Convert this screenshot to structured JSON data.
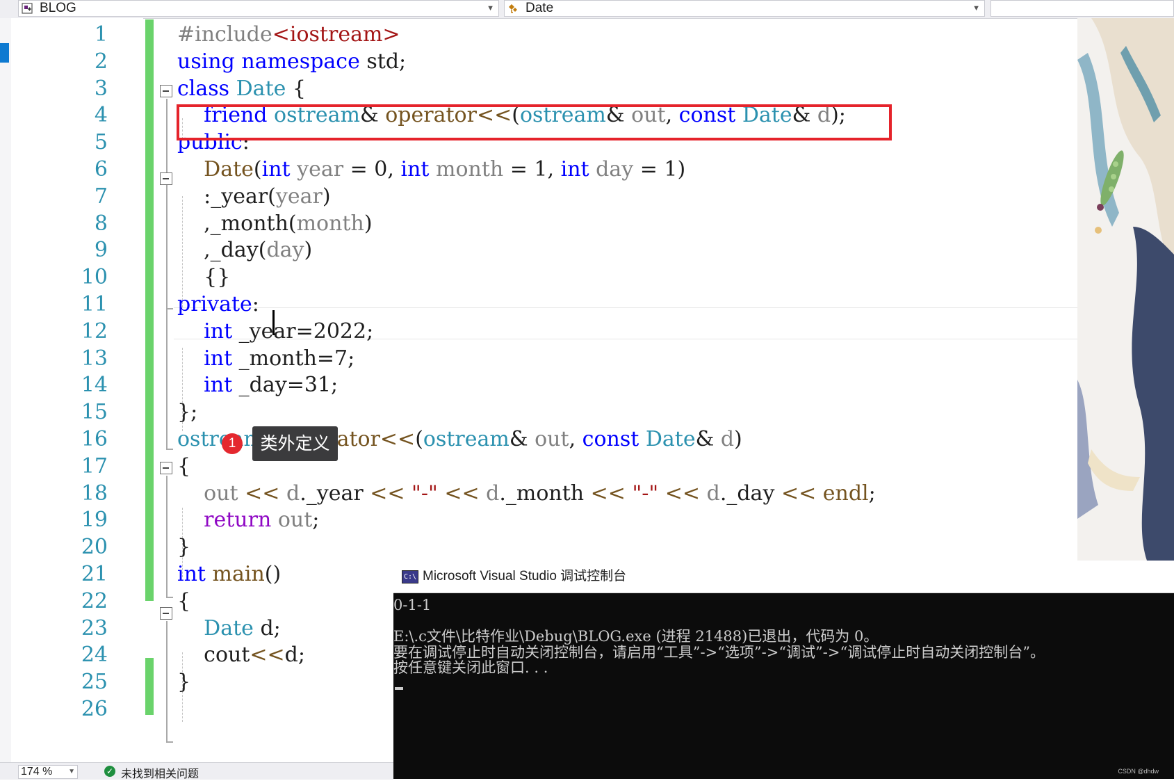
{
  "nav": {
    "project": "BLOG",
    "member": "Date",
    "right": ""
  },
  "editor": {
    "line_numbers": [
      "1",
      "2",
      "3",
      "4",
      "5",
      "6",
      "7",
      "8",
      "9",
      "10",
      "11",
      "12",
      "13",
      "14",
      "15",
      "16",
      "17",
      "18",
      "19",
      "20",
      "21",
      "22",
      "23",
      "24",
      "25",
      "26"
    ],
    "lines": [
      [
        {
          "t": "#include",
          "c": "pp"
        },
        {
          "t": "<iostream>",
          "c": "inc"
        }
      ],
      [
        {
          "t": "using",
          "c": "kw"
        },
        {
          "t": " "
        },
        {
          "t": "namespace",
          "c": "kw"
        },
        {
          "t": " std;"
        }
      ],
      [
        {
          "t": "class",
          "c": "kw"
        },
        {
          "t": " "
        },
        {
          "t": "Date",
          "c": "ty"
        },
        {
          "t": " {"
        }
      ],
      [
        {
          "t": "    "
        },
        {
          "t": "friend",
          "c": "kw"
        },
        {
          "t": " "
        },
        {
          "t": "ostream",
          "c": "ty"
        },
        {
          "t": "& "
        },
        {
          "t": "operator<<",
          "c": "fn"
        },
        {
          "t": "("
        },
        {
          "t": "ostream",
          "c": "ty"
        },
        {
          "t": "& "
        },
        {
          "t": "out",
          "c": "pm"
        },
        {
          "t": ", "
        },
        {
          "t": "const",
          "c": "kw"
        },
        {
          "t": " "
        },
        {
          "t": "Date",
          "c": "ty"
        },
        {
          "t": "& "
        },
        {
          "t": "d",
          "c": "pm"
        },
        {
          "t": ");"
        }
      ],
      [
        {
          "t": "public",
          "c": "kw"
        },
        {
          "t": ":"
        }
      ],
      [
        {
          "t": "    "
        },
        {
          "t": "Date",
          "c": "fn"
        },
        {
          "t": "("
        },
        {
          "t": "int",
          "c": "kw"
        },
        {
          "t": " "
        },
        {
          "t": "year",
          "c": "pm"
        },
        {
          "t": " = 0, "
        },
        {
          "t": "int",
          "c": "kw"
        },
        {
          "t": " "
        },
        {
          "t": "month",
          "c": "pm"
        },
        {
          "t": " = 1, "
        },
        {
          "t": "int",
          "c": "kw"
        },
        {
          "t": " "
        },
        {
          "t": "day",
          "c": "pm"
        },
        {
          "t": " = 1)"
        }
      ],
      [
        {
          "t": "    :_year("
        },
        {
          "t": "year",
          "c": "pm"
        },
        {
          "t": ")"
        }
      ],
      [
        {
          "t": "    ,_month("
        },
        {
          "t": "month",
          "c": "pm"
        },
        {
          "t": ")"
        }
      ],
      [
        {
          "t": "    ,_day("
        },
        {
          "t": "day",
          "c": "pm"
        },
        {
          "t": ")"
        }
      ],
      [
        {
          "t": "    {}"
        }
      ],
      [
        {
          "t": "private",
          "c": "kw"
        },
        {
          "t": ":"
        }
      ],
      [
        {
          "t": "    "
        },
        {
          "t": "int",
          "c": "kw"
        },
        {
          "t": " _year=2022;"
        }
      ],
      [
        {
          "t": "    "
        },
        {
          "t": "int",
          "c": "kw"
        },
        {
          "t": " _month=7;"
        }
      ],
      [
        {
          "t": "    "
        },
        {
          "t": "int",
          "c": "kw"
        },
        {
          "t": " _day=31;"
        }
      ],
      [
        {
          "t": "};"
        }
      ],
      [
        {
          "t": "ostream",
          "c": "ty"
        },
        {
          "t": "& "
        },
        {
          "t": "operator<<",
          "c": "fn"
        },
        {
          "t": "("
        },
        {
          "t": "ostream",
          "c": "ty"
        },
        {
          "t": "& "
        },
        {
          "t": "out",
          "c": "pm"
        },
        {
          "t": ", "
        },
        {
          "t": "const",
          "c": "kw"
        },
        {
          "t": " "
        },
        {
          "t": "Date",
          "c": "ty"
        },
        {
          "t": "& "
        },
        {
          "t": "d",
          "c": "pm"
        },
        {
          "t": ")"
        }
      ],
      [
        {
          "t": "{"
        }
      ],
      [
        {
          "t": "    "
        },
        {
          "t": "out",
          "c": "pm"
        },
        {
          "t": " "
        },
        {
          "t": "<<",
          "c": "fn"
        },
        {
          "t": " "
        },
        {
          "t": "d",
          "c": "pm"
        },
        {
          "t": "._year "
        },
        {
          "t": "<<",
          "c": "fn"
        },
        {
          "t": " "
        },
        {
          "t": "\"-\"",
          "c": "st"
        },
        {
          "t": " "
        },
        {
          "t": "<<",
          "c": "fn"
        },
        {
          "t": " "
        },
        {
          "t": "d",
          "c": "pm"
        },
        {
          "t": "._month "
        },
        {
          "t": "<<",
          "c": "fn"
        },
        {
          "t": " "
        },
        {
          "t": "\"-\"",
          "c": "st"
        },
        {
          "t": " "
        },
        {
          "t": "<<",
          "c": "fn"
        },
        {
          "t": " "
        },
        {
          "t": "d",
          "c": "pm"
        },
        {
          "t": "._day "
        },
        {
          "t": "<<",
          "c": "fn"
        },
        {
          "t": " "
        },
        {
          "t": "endl",
          "c": "fn"
        },
        {
          "t": ";"
        }
      ],
      [
        {
          "t": "    "
        },
        {
          "t": "return",
          "c": "ctl"
        },
        {
          "t": " "
        },
        {
          "t": "out",
          "c": "pm"
        },
        {
          "t": ";"
        }
      ],
      [
        {
          "t": "}"
        }
      ],
      [
        {
          "t": "int",
          "c": "kw"
        },
        {
          "t": " "
        },
        {
          "t": "main",
          "c": "fn"
        },
        {
          "t": "()"
        }
      ],
      [
        {
          "t": "{"
        }
      ],
      [
        {
          "t": "    "
        },
        {
          "t": "Date",
          "c": "ty"
        },
        {
          "t": " d;"
        }
      ],
      [
        {
          "t": "    cout"
        },
        {
          "t": "<<",
          "c": "fn"
        },
        {
          "t": "d;"
        }
      ],
      [
        {
          "t": "}"
        }
      ],
      [
        {
          "t": ""
        }
      ]
    ]
  },
  "annotation": {
    "badge_number": "1",
    "tooltip": "类外定义"
  },
  "status_bar": {
    "zoom": "174 %",
    "message": "未找到相关问题"
  },
  "console": {
    "title": "Microsoft Visual Studio 调试控制台",
    "icon_label": "C:\\",
    "lines": [
      "0-1-1",
      "",
      "E:\\.c文件\\比特作业\\Debug\\BLOG.exe (进程 21488)已退出，代码为 0。",
      "要在调试停止时自动关闭控制台，请启用“工具”->“选项”->“调试”->“调试停止时自动关闭控制台”。",
      "按任意键关闭此窗口. . ."
    ],
    "watermark": "CSDN @dhdw"
  },
  "colors": {
    "keyword": "#0000ff",
    "type": "#2b91af",
    "function": "#74531f",
    "parameter": "#808080",
    "string": "#a31515",
    "control": "#8f08c4",
    "highlight_box": "#e5232b",
    "change_bar": "#6ad36b"
  }
}
